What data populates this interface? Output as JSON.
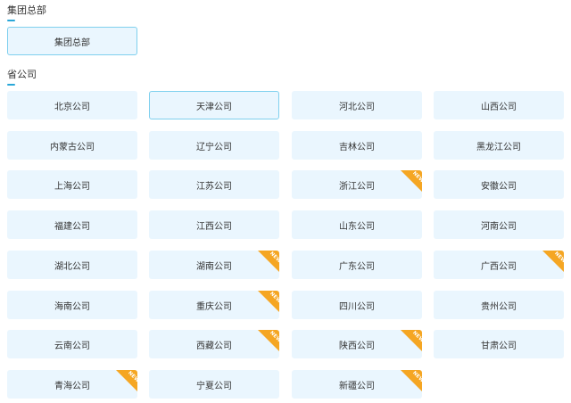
{
  "group_section": {
    "title": "集团总部",
    "items": [
      {
        "label": "集团总部",
        "selected": true
      }
    ]
  },
  "province_section": {
    "title": "省公司",
    "badge_text": "NEW",
    "items": [
      {
        "label": "北京公司",
        "new": false,
        "selected": false
      },
      {
        "label": "天津公司",
        "new": false,
        "selected": true
      },
      {
        "label": "河北公司",
        "new": false,
        "selected": false
      },
      {
        "label": "山西公司",
        "new": false,
        "selected": false
      },
      {
        "label": "内蒙古公司",
        "new": false,
        "selected": false
      },
      {
        "label": "辽宁公司",
        "new": false,
        "selected": false
      },
      {
        "label": "吉林公司",
        "new": false,
        "selected": false
      },
      {
        "label": "黑龙江公司",
        "new": false,
        "selected": false
      },
      {
        "label": "上海公司",
        "new": false,
        "selected": false
      },
      {
        "label": "江苏公司",
        "new": false,
        "selected": false
      },
      {
        "label": "浙江公司",
        "new": true,
        "selected": false
      },
      {
        "label": "安徽公司",
        "new": false,
        "selected": false
      },
      {
        "label": "福建公司",
        "new": false,
        "selected": false
      },
      {
        "label": "江西公司",
        "new": false,
        "selected": false
      },
      {
        "label": "山东公司",
        "new": false,
        "selected": false
      },
      {
        "label": "河南公司",
        "new": false,
        "selected": false
      },
      {
        "label": "湖北公司",
        "new": false,
        "selected": false
      },
      {
        "label": "湖南公司",
        "new": true,
        "selected": false
      },
      {
        "label": "广东公司",
        "new": false,
        "selected": false
      },
      {
        "label": "广西公司",
        "new": true,
        "selected": false
      },
      {
        "label": "海南公司",
        "new": false,
        "selected": false
      },
      {
        "label": "重庆公司",
        "new": true,
        "selected": false
      },
      {
        "label": "四川公司",
        "new": false,
        "selected": false
      },
      {
        "label": "贵州公司",
        "new": false,
        "selected": false
      },
      {
        "label": "云南公司",
        "new": false,
        "selected": false
      },
      {
        "label": "西藏公司",
        "new": true,
        "selected": false
      },
      {
        "label": "陕西公司",
        "new": true,
        "selected": false
      },
      {
        "label": "甘肃公司",
        "new": false,
        "selected": false
      },
      {
        "label": "青海公司",
        "new": true,
        "selected": false
      },
      {
        "label": "宁夏公司",
        "new": false,
        "selected": false
      },
      {
        "label": "新疆公司",
        "new": true,
        "selected": false
      }
    ]
  }
}
